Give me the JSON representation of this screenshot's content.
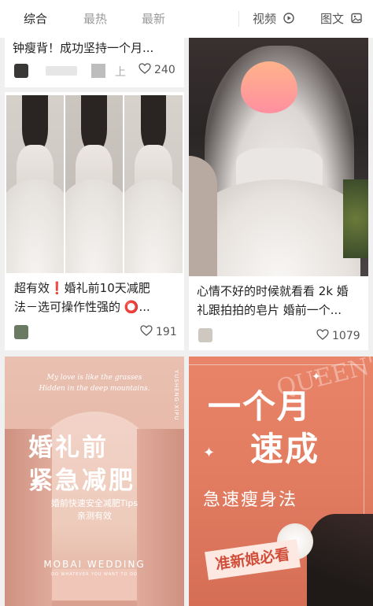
{
  "tabs": [
    {
      "label": "综合"
    },
    {
      "label": "最热"
    },
    {
      "label": "最新"
    }
  ],
  "filters": {
    "video": "视频",
    "imgtext": "图文"
  },
  "cards": [
    {
      "title": "钟瘦背！成功坚持一个月...",
      "meta_suffix": "上",
      "likes": "240"
    },
    {
      "title_line1": "超有效❗婚礼前10天减肥",
      "title_line2": "法－选可操作性强的 ⭕...",
      "likes": "191"
    },
    {
      "title_line1": "心情不好的时候就看看 2k 婚",
      "title_line2": "礼跟拍拍的皂片 婚前一个...",
      "likes": "1079"
    }
  ],
  "poster_left": {
    "poem_line1": "My love is like the grasses",
    "poem_line2": "Hidden in the deep mountains.",
    "headline1": "婚礼前",
    "headline2": "紧急减肥",
    "tips1": "婚前快速安全减肥Tips",
    "tips2": "亲测有效",
    "brand": "MOBAI WEDDING",
    "brand_sub": "DO WHATEVER YOU WANT TO DO"
  },
  "poster_right": {
    "script_text": "QUEEN'S",
    "headline1": "一个月",
    "headline2": "速成",
    "subtitle": "急速瘦身法",
    "badge": "准新娘必看",
    "vertical_text": "YUSHENG·XIPU"
  },
  "colors": {
    "accent_dark": "#222222",
    "muted": "#9a9a9a",
    "poster_left_bg": "#e6b6a6",
    "poster_right_bg": "#e27c61"
  }
}
